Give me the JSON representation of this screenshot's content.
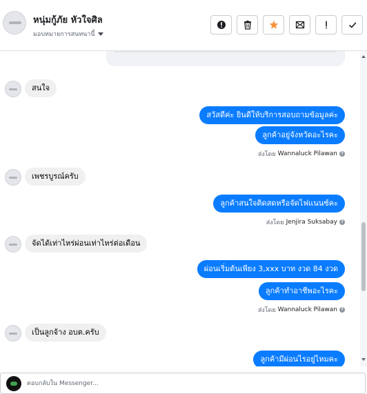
{
  "header": {
    "contact_name": "หนุ่มกู้ภัย หัวใจศิล",
    "assign_label": "มอบหมายการสนทนานี้"
  },
  "toolbar": {
    "buttons": [
      {
        "icon": "spam-icon"
      },
      {
        "icon": "trash-icon"
      },
      {
        "icon": "star-icon",
        "color": "#f7923a"
      },
      {
        "icon": "mark-unread-icon"
      },
      {
        "icon": "follow-up-icon"
      },
      {
        "icon": "done-icon"
      }
    ]
  },
  "messages": [
    {
      "dir": "in",
      "text": "สนใจ"
    },
    {
      "dir": "out",
      "text": "สวัสดีค่ะ  ยินดีให้บริการสอบถามข้อมูลค่ะ"
    },
    {
      "dir": "out",
      "text": "ลูกค้าอยู่จังหวัดอะไรคะ"
    },
    {
      "sent_by_prefix": "ส่งโดย",
      "sender": "Wannaluck Pilawan"
    },
    {
      "dir": "in",
      "text": "เพชรบูรณ์ครับ"
    },
    {
      "dir": "out",
      "text": "ลูกค้าสนใจติดสดหรือจัดไฟแนนซ์คะ"
    },
    {
      "sent_by_prefix": "ส่งโดย",
      "sender": "Jenjira Suksabay"
    },
    {
      "dir": "in",
      "text": "จัดได้เท่าไหร่ผ่อนเท่าไหร่ต่อเดือน"
    },
    {
      "dir": "out",
      "text": "ผ่อนเริ่มต้นเพียง 3,xxx บาท งวด 84 งวด"
    },
    {
      "dir": "out",
      "text": "ลูกค้าทำอาชีพอะไรคะ"
    },
    {
      "sent_by_prefix": "ส่งโดย",
      "sender": "Wannaluck Pilawan"
    },
    {
      "dir": "in",
      "text": "เป็นลูกจ้าง อบต.ครับ"
    },
    {
      "dir": "out",
      "text": "ลูกค้ามีผ่อนไรอยู่ไหมคะ"
    }
  ],
  "composer": {
    "placeholder": "ตอบกลับใน Messenger..."
  },
  "colors": {
    "outgoing_bubble": "#0a7cff",
    "incoming_bubble": "#f0f0f0"
  }
}
